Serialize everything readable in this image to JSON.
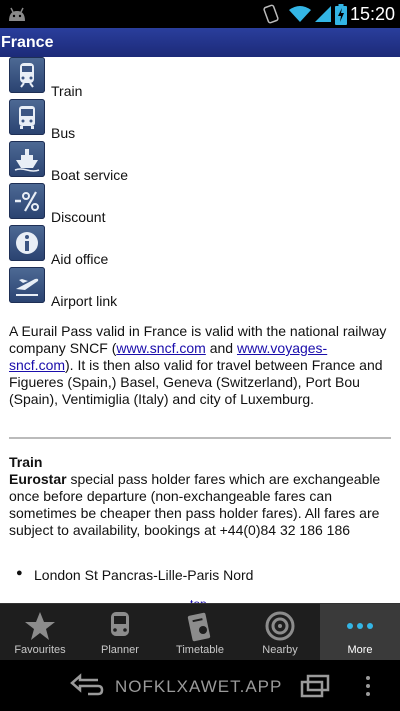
{
  "status_bar": {
    "time": "15:20"
  },
  "title": "France",
  "legend": [
    {
      "icon": "train-icon",
      "label": "Train"
    },
    {
      "icon": "bus-icon",
      "label": "Bus"
    },
    {
      "icon": "boat-icon",
      "label": "Boat service"
    },
    {
      "icon": "discount-icon",
      "label": "Discount"
    },
    {
      "icon": "info-icon",
      "label": "Aid office"
    },
    {
      "icon": "airplane-icon",
      "label": "Airport link"
    }
  ],
  "intro": {
    "text_1": "A Eurail Pass valid in France is valid with the national railway company SNCF (",
    "link_1": "www.sncf.com",
    "text_2": " and ",
    "link_2": "www.voyages-sncf.com",
    "text_3": "). It is then also valid for travel between France and Figueres (Spain,) Basel, Geneva (Switzerland), Port Bou (Spain), Ventimiglia (Italy) and city of Luxemburg."
  },
  "train_section": {
    "heading": "Train",
    "eurostar_label": "Eurostar",
    "eurostar_text": "  special pass holder fares which are exchangeable once before departure (non-exchangeable fares can sometimes be cheaper then pass holder fares). All fares are subject to availability, bookings at +44(0)84 32 186 186",
    "routes": [
      "London St Pancras-Lille-Paris Nord"
    ],
    "top_link": "top"
  },
  "tabs": [
    {
      "label": "Favourites",
      "icon": "star-icon",
      "active": false
    },
    {
      "label": "Planner",
      "icon": "train-front-icon",
      "active": false
    },
    {
      "label": "Timetable",
      "icon": "timetable-icon",
      "active": false
    },
    {
      "label": "Nearby",
      "icon": "target-icon",
      "active": false
    },
    {
      "label": "More",
      "icon": "more-dots-icon",
      "active": true
    }
  ],
  "watermark": "NOFKLXAWET.APP",
  "colors": {
    "title_bar": "#23348a",
    "tab_bar": "#1e1e1e",
    "active_tab": "#3a3a3a",
    "link": "#1a0dab",
    "icon_tile": "#3b5583"
  }
}
